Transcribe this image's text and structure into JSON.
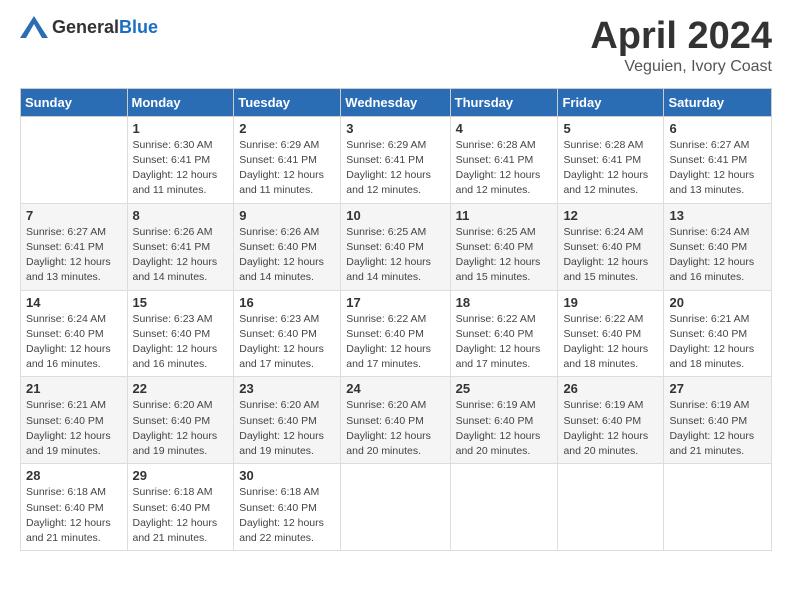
{
  "logo": {
    "general": "General",
    "blue": "Blue"
  },
  "title": "April 2024",
  "location": "Veguien, Ivory Coast",
  "days_of_week": [
    "Sunday",
    "Monday",
    "Tuesday",
    "Wednesday",
    "Thursday",
    "Friday",
    "Saturday"
  ],
  "weeks": [
    [
      {
        "day": "",
        "sunrise": "",
        "sunset": "",
        "daylight": ""
      },
      {
        "day": "1",
        "sunrise": "Sunrise: 6:30 AM",
        "sunset": "Sunset: 6:41 PM",
        "daylight": "Daylight: 12 hours and 11 minutes."
      },
      {
        "day": "2",
        "sunrise": "Sunrise: 6:29 AM",
        "sunset": "Sunset: 6:41 PM",
        "daylight": "Daylight: 12 hours and 11 minutes."
      },
      {
        "day": "3",
        "sunrise": "Sunrise: 6:29 AM",
        "sunset": "Sunset: 6:41 PM",
        "daylight": "Daylight: 12 hours and 12 minutes."
      },
      {
        "day": "4",
        "sunrise": "Sunrise: 6:28 AM",
        "sunset": "Sunset: 6:41 PM",
        "daylight": "Daylight: 12 hours and 12 minutes."
      },
      {
        "day": "5",
        "sunrise": "Sunrise: 6:28 AM",
        "sunset": "Sunset: 6:41 PM",
        "daylight": "Daylight: 12 hours and 12 minutes."
      },
      {
        "day": "6",
        "sunrise": "Sunrise: 6:27 AM",
        "sunset": "Sunset: 6:41 PM",
        "daylight": "Daylight: 12 hours and 13 minutes."
      }
    ],
    [
      {
        "day": "7",
        "sunrise": "Sunrise: 6:27 AM",
        "sunset": "Sunset: 6:41 PM",
        "daylight": "Daylight: 12 hours and 13 minutes."
      },
      {
        "day": "8",
        "sunrise": "Sunrise: 6:26 AM",
        "sunset": "Sunset: 6:41 PM",
        "daylight": "Daylight: 12 hours and 14 minutes."
      },
      {
        "day": "9",
        "sunrise": "Sunrise: 6:26 AM",
        "sunset": "Sunset: 6:40 PM",
        "daylight": "Daylight: 12 hours and 14 minutes."
      },
      {
        "day": "10",
        "sunrise": "Sunrise: 6:25 AM",
        "sunset": "Sunset: 6:40 PM",
        "daylight": "Daylight: 12 hours and 14 minutes."
      },
      {
        "day": "11",
        "sunrise": "Sunrise: 6:25 AM",
        "sunset": "Sunset: 6:40 PM",
        "daylight": "Daylight: 12 hours and 15 minutes."
      },
      {
        "day": "12",
        "sunrise": "Sunrise: 6:24 AM",
        "sunset": "Sunset: 6:40 PM",
        "daylight": "Daylight: 12 hours and 15 minutes."
      },
      {
        "day": "13",
        "sunrise": "Sunrise: 6:24 AM",
        "sunset": "Sunset: 6:40 PM",
        "daylight": "Daylight: 12 hours and 16 minutes."
      }
    ],
    [
      {
        "day": "14",
        "sunrise": "Sunrise: 6:24 AM",
        "sunset": "Sunset: 6:40 PM",
        "daylight": "Daylight: 12 hours and 16 minutes."
      },
      {
        "day": "15",
        "sunrise": "Sunrise: 6:23 AM",
        "sunset": "Sunset: 6:40 PM",
        "daylight": "Daylight: 12 hours and 16 minutes."
      },
      {
        "day": "16",
        "sunrise": "Sunrise: 6:23 AM",
        "sunset": "Sunset: 6:40 PM",
        "daylight": "Daylight: 12 hours and 17 minutes."
      },
      {
        "day": "17",
        "sunrise": "Sunrise: 6:22 AM",
        "sunset": "Sunset: 6:40 PM",
        "daylight": "Daylight: 12 hours and 17 minutes."
      },
      {
        "day": "18",
        "sunrise": "Sunrise: 6:22 AM",
        "sunset": "Sunset: 6:40 PM",
        "daylight": "Daylight: 12 hours and 17 minutes."
      },
      {
        "day": "19",
        "sunrise": "Sunrise: 6:22 AM",
        "sunset": "Sunset: 6:40 PM",
        "daylight": "Daylight: 12 hours and 18 minutes."
      },
      {
        "day": "20",
        "sunrise": "Sunrise: 6:21 AM",
        "sunset": "Sunset: 6:40 PM",
        "daylight": "Daylight: 12 hours and 18 minutes."
      }
    ],
    [
      {
        "day": "21",
        "sunrise": "Sunrise: 6:21 AM",
        "sunset": "Sunset: 6:40 PM",
        "daylight": "Daylight: 12 hours and 19 minutes."
      },
      {
        "day": "22",
        "sunrise": "Sunrise: 6:20 AM",
        "sunset": "Sunset: 6:40 PM",
        "daylight": "Daylight: 12 hours and 19 minutes."
      },
      {
        "day": "23",
        "sunrise": "Sunrise: 6:20 AM",
        "sunset": "Sunset: 6:40 PM",
        "daylight": "Daylight: 12 hours and 19 minutes."
      },
      {
        "day": "24",
        "sunrise": "Sunrise: 6:20 AM",
        "sunset": "Sunset: 6:40 PM",
        "daylight": "Daylight: 12 hours and 20 minutes."
      },
      {
        "day": "25",
        "sunrise": "Sunrise: 6:19 AM",
        "sunset": "Sunset: 6:40 PM",
        "daylight": "Daylight: 12 hours and 20 minutes."
      },
      {
        "day": "26",
        "sunrise": "Sunrise: 6:19 AM",
        "sunset": "Sunset: 6:40 PM",
        "daylight": "Daylight: 12 hours and 20 minutes."
      },
      {
        "day": "27",
        "sunrise": "Sunrise: 6:19 AM",
        "sunset": "Sunset: 6:40 PM",
        "daylight": "Daylight: 12 hours and 21 minutes."
      }
    ],
    [
      {
        "day": "28",
        "sunrise": "Sunrise: 6:18 AM",
        "sunset": "Sunset: 6:40 PM",
        "daylight": "Daylight: 12 hours and 21 minutes."
      },
      {
        "day": "29",
        "sunrise": "Sunrise: 6:18 AM",
        "sunset": "Sunset: 6:40 PM",
        "daylight": "Daylight: 12 hours and 21 minutes."
      },
      {
        "day": "30",
        "sunrise": "Sunrise: 6:18 AM",
        "sunset": "Sunset: 6:40 PM",
        "daylight": "Daylight: 12 hours and 22 minutes."
      },
      {
        "day": "",
        "sunrise": "",
        "sunset": "",
        "daylight": ""
      },
      {
        "day": "",
        "sunrise": "",
        "sunset": "",
        "daylight": ""
      },
      {
        "day": "",
        "sunrise": "",
        "sunset": "",
        "daylight": ""
      },
      {
        "day": "",
        "sunrise": "",
        "sunset": "",
        "daylight": ""
      }
    ]
  ]
}
